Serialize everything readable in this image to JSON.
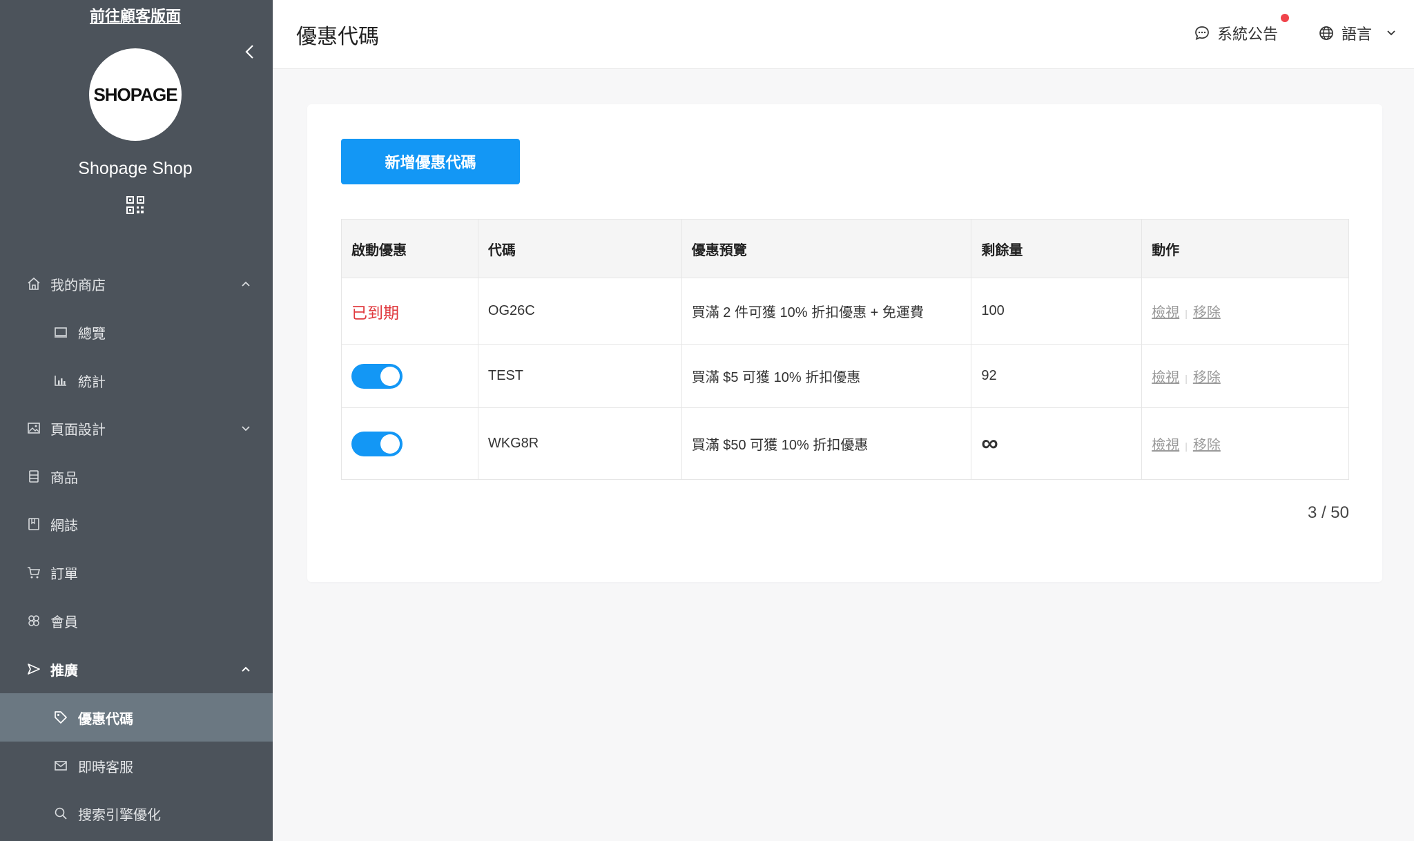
{
  "sidebar": {
    "visit_link": "前往顧客版面",
    "logo_text": "SHOPAGE",
    "shop_name": "Shopage Shop",
    "items": [
      {
        "label": "我的商店",
        "icon": "home-icon"
      },
      {
        "label": "總覽",
        "icon": "monitor-icon"
      },
      {
        "label": "統計",
        "icon": "chart-icon"
      },
      {
        "label": "頁面設計",
        "icon": "image-icon"
      },
      {
        "label": "商品",
        "icon": "product-icon"
      },
      {
        "label": "網誌",
        "icon": "book-icon"
      },
      {
        "label": "訂單",
        "icon": "cart-icon"
      },
      {
        "label": "會員",
        "icon": "members-icon"
      },
      {
        "label": "推廣",
        "icon": "promotion-icon"
      },
      {
        "label": "優惠代碼",
        "icon": "tag-icon"
      },
      {
        "label": "即時客服",
        "icon": "mail-icon"
      },
      {
        "label": "搜索引擎優化",
        "icon": "search-icon"
      }
    ]
  },
  "header": {
    "title": "優惠代碼",
    "notice_label": "系統公告",
    "language_label": "語言"
  },
  "main": {
    "add_button": "新增優惠代碼",
    "columns": [
      "啟動優惠",
      "代碼",
      "優惠預覽",
      "剩餘量",
      "動作"
    ],
    "rows": [
      {
        "status": "已到期",
        "enabled": null,
        "code": "OG26C",
        "preview": "買滿 2 件可獲 10% 折扣優惠 + 免運費",
        "remaining": "100"
      },
      {
        "status": null,
        "enabled": true,
        "code": "TEST",
        "preview": "買滿 $5 可獲 10% 折扣優惠",
        "remaining": "92"
      },
      {
        "status": null,
        "enabled": true,
        "code": "WKG8R",
        "preview": "買滿 $50 可獲 10% 折扣優惠",
        "remaining": "∞"
      }
    ],
    "action_view": "檢視",
    "action_remove": "移除",
    "pagination": "3 / 50"
  },
  "colors": {
    "sidebar_bg": "#4c535b",
    "sidebar_active": "#6b7882",
    "accent": "#1397f5",
    "expired": "#e0393e",
    "notice_dot": "#f0434b"
  }
}
